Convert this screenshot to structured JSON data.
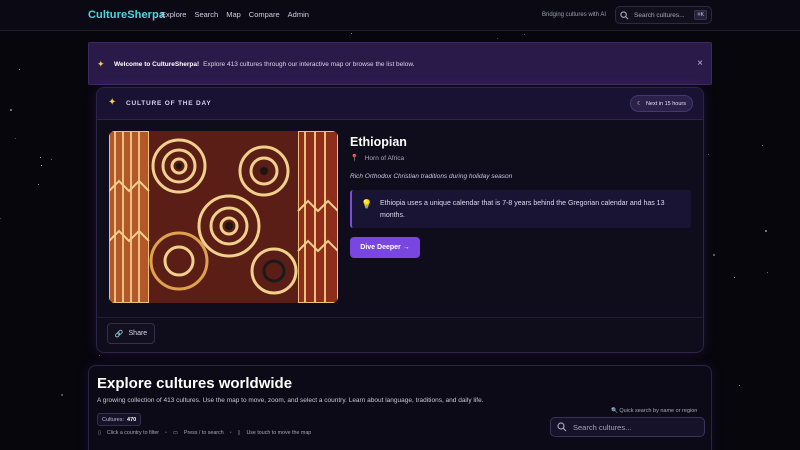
{
  "nav": {
    "brand": "CultureSherpa",
    "links": [
      "Explore",
      "Search",
      "Map",
      "Compare",
      "Admin"
    ],
    "tagline": "Bridging cultures with AI",
    "search_placeholder": "Search cultures...",
    "shortcut": "⌘K"
  },
  "banner": {
    "title": "Welcome to CultureSherpa!",
    "text": "Explore 413 cultures through our interactive map or browse the list below.",
    "close": "×"
  },
  "culture_of_day": {
    "heading": "CULTURE OF THE DAY",
    "next_label": "Next in 15 hours",
    "name": "Ethiopian",
    "region": "Horn of Africa",
    "description": "Rich Orthodox Christian traditions during holiday season",
    "fact": "Ethiopia uses a unique calendar that is 7-8 years behind the Gregorian calendar and has 13 months.",
    "cta": "Dive Deeper →",
    "share": "Share"
  },
  "explore": {
    "title": "Explore cultures worldwide",
    "description": "A growing collection of 413 cultures. Use the map to move, zoom, and select a country. Learn about language, traditions, and daily life.",
    "count_label": "Cultures:",
    "count_value": "470",
    "hints": [
      "Click a country to filter",
      "Press / to search",
      "Use touch to move the map"
    ],
    "quick_search_label": "Quick search by name or region",
    "search_placeholder": "Search cultures..."
  },
  "colors": {
    "brand": "#4fd6e3",
    "accent": "#7a46e0",
    "banner_bg": "#2a1a4a",
    "background": "#07060d"
  },
  "icons": [
    "sparkle-icon",
    "search-icon",
    "close-icon",
    "moon-icon",
    "pin-icon",
    "lightbulb-icon",
    "link-icon",
    "mouse-icon",
    "keyboard-icon",
    "phone-icon"
  ]
}
